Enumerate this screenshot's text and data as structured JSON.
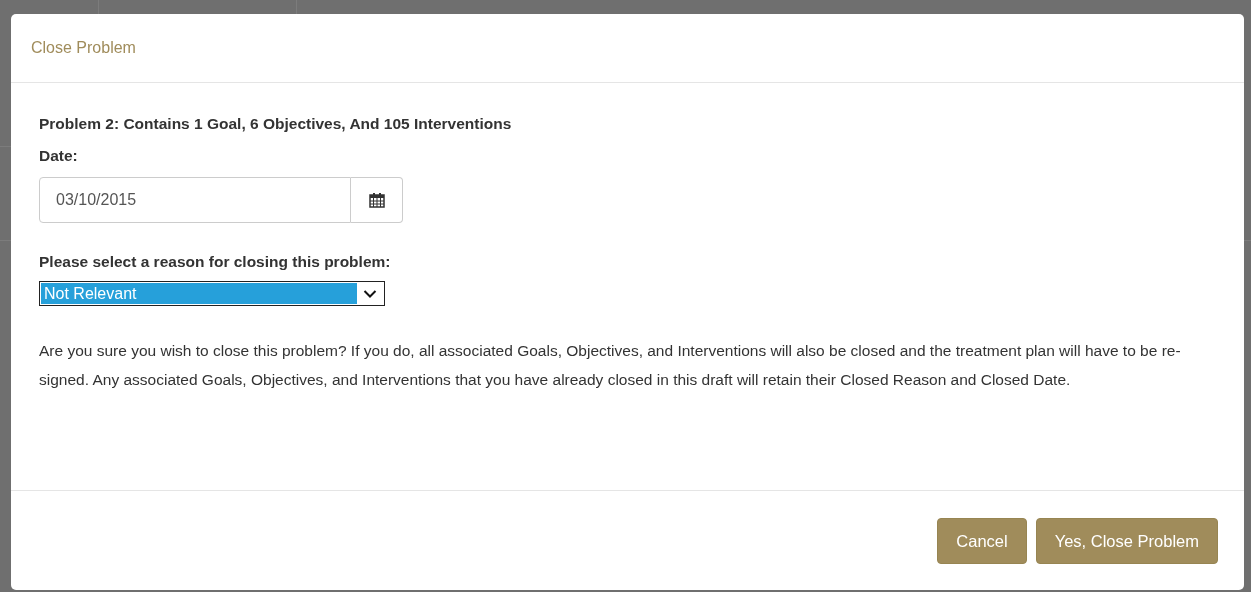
{
  "dialog": {
    "title": "Close Problem",
    "heading": "Problem 2: Contains 1 Goal, 6 Objectives, And 105 Interventions",
    "date_label": "Date:",
    "date_value": "03/10/2015",
    "reason_label": "Please select a reason for closing this problem:",
    "reason_value": "Not Relevant",
    "message": "Are you sure you wish to close this problem? If you do, all associated Goals, Objectives, and Interventions will also be closed and the treatment plan will have to be re-signed. Any associated Goals, Objectives, and Interventions that you have already closed in this draft will retain their Closed Reason and Closed Date.",
    "buttons": [
      "Cancel",
      "Yes, Close Problem"
    ]
  }
}
